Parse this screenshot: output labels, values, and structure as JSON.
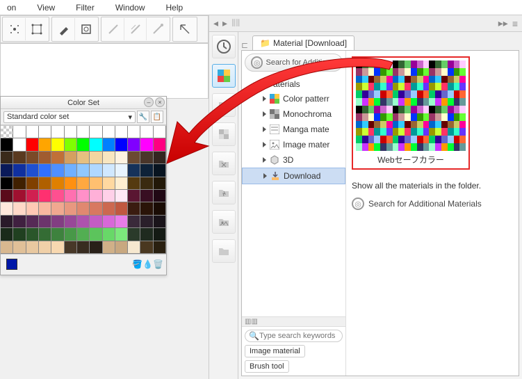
{
  "menu": {
    "items": [
      "on",
      "View",
      "Filter",
      "Window",
      "Help"
    ]
  },
  "colorset": {
    "title": "Color Set",
    "dropdown_label": "Standard color set",
    "rows": [
      [
        "alpha",
        "#ffffff",
        "#ffffff",
        "#ffffff",
        "#ffffff",
        "#ffffff",
        "#ffffff",
        "#ffffff",
        "#ffffff",
        "#ffffff",
        "#ffffff",
        "#ffffff",
        "#ffffff"
      ],
      [
        "#000000",
        "#ffffff",
        "#ff0000",
        "#ffa500",
        "#ffff00",
        "#7fff00",
        "#00ff00",
        "#00ffff",
        "#0080ff",
        "#0000ff",
        "#8000ff",
        "#ff00ff",
        "#ff0080"
      ],
      [
        "#3a2a1a",
        "#5a3a20",
        "#7a4a28",
        "#a05c30",
        "#c07038",
        "#d4a060",
        "#e6c080",
        "#f2d6a0",
        "#f8e6c0",
        "#fdf2e0",
        "#6b4a32",
        "#4a362a",
        "#332620"
      ],
      [
        "#0a1a5a",
        "#1030a0",
        "#2050d0",
        "#3070ff",
        "#5090ff",
        "#70b0ff",
        "#90c8ff",
        "#b0d8ff",
        "#d0e8ff",
        "#e8f4ff",
        "#16325a",
        "#0e2238",
        "#081420"
      ],
      [
        "#000000",
        "#402000",
        "#804000",
        "#b06000",
        "#e08000",
        "#ff9010",
        "#ffa840",
        "#ffc070",
        "#ffd8a0",
        "#ffeed0",
        "#553a10",
        "#3a2a10",
        "#221808"
      ],
      [
        "#5a0a1a",
        "#a01030",
        "#d02050",
        "#ff3070",
        "#ff5090",
        "#ff70b0",
        "#ff90c8",
        "#ffb0d8",
        "#ffd0e8",
        "#ffe8f4",
        "#5a1632",
        "#380e22",
        "#200814"
      ],
      [
        "#ffe8dc",
        "#ffd8c8",
        "#ffc8b4",
        "#f8b8a0",
        "#f0a890",
        "#e89880",
        "#e08870",
        "#d87860",
        "#cc6850",
        "#c05840",
        "#3a1c10",
        "#2a1408",
        "#1a0c04"
      ],
      [
        "#2a1a2a",
        "#402040",
        "#562a56",
        "#6c346c",
        "#823e82",
        "#984898",
        "#ae52ae",
        "#c45cc4",
        "#d868d8",
        "#e87ce8",
        "#3a2a3a",
        "#2a1f2a",
        "#1a141a"
      ],
      [
        "#1a2a1a",
        "#204020",
        "#2a562a",
        "#346c34",
        "#3e823e",
        "#489848",
        "#52ae52",
        "#5cc45c",
        "#68d868",
        "#7ce87c",
        "#2a3a2a",
        "#1f2a1f",
        "#141a14"
      ],
      [
        "#d8b890",
        "#e0c098",
        "#e8c8a0",
        "#f0d0a8",
        "#f8d8b0",
        "#483828",
        "#382c20",
        "#282018",
        "#d0b088",
        "#c8a880",
        "#f6e8d0",
        "#4a3820",
        "#2a2010"
      ]
    ],
    "selected_color": "#0018a8"
  },
  "material_panel": {
    "tab_label": "Material [Download]",
    "search_button_label": "Search for Additional",
    "tree": {
      "root": "aterials",
      "items": [
        {
          "icon": "color-pattern-icon",
          "label": "Color patterr"
        },
        {
          "icon": "monochrome-icon",
          "label": "Monochroma"
        },
        {
          "icon": "manga-icon",
          "label": "Manga mate"
        },
        {
          "icon": "image-icon",
          "label": "Image mater"
        },
        {
          "icon": "3d-icon",
          "label": "3D"
        },
        {
          "icon": "download-icon",
          "label": "Download",
          "selected": true
        }
      ]
    },
    "search_placeholder": "Type search keywords",
    "tags": [
      "Image material",
      "Brush tool"
    ],
    "thumbnail": {
      "label": "Webセーフカラー"
    },
    "hint": "Show all the materials in the folder.",
    "search2_label": "Search for Additional Materials"
  }
}
